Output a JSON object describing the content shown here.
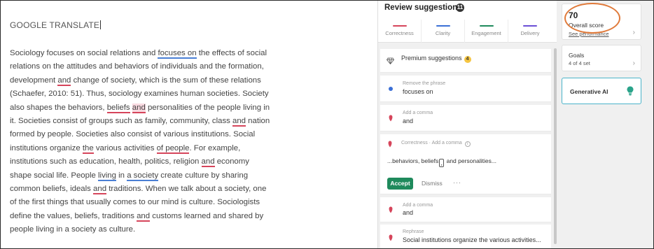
{
  "editor": {
    "doc_title": "GOOGLE TRANSLATE",
    "lines": [
      [
        {
          "t": "Sociology focuses on social relations and "
        },
        {
          "t": "focuses on",
          "u": "ub"
        },
        {
          "t": " the effects of social"
        }
      ],
      [
        {
          "t": "relations on the attitudes and behaviors of individuals and the formation,"
        }
      ],
      [
        {
          "t": "development "
        },
        {
          "t": "and",
          "u": "ur"
        },
        {
          "t": " change of society, which is the sum of these relations"
        }
      ],
      [
        {
          "t": "(Schaefer, 2010: 51). Thus, sociology examines human societies. Society"
        }
      ],
      [
        {
          "t": "also shapes the behaviors, "
        },
        {
          "t": "beliefs",
          "u": "ur"
        },
        {
          "t": " "
        },
        {
          "t": "and",
          "u": "hl"
        },
        {
          "t": " personalities of the people living in"
        }
      ],
      [
        {
          "t": "it. Societies consist of groups such as family, community, class "
        },
        {
          "t": "and",
          "u": "ur"
        },
        {
          "t": " nation"
        }
      ],
      [
        {
          "t": "formed by people. Societies also consist of various institutions. Social"
        }
      ],
      [
        {
          "t": "institutions organize "
        },
        {
          "t": "the",
          "u": "ur"
        },
        {
          "t": " various activities "
        },
        {
          "t": "of people",
          "u": "ur"
        },
        {
          "t": ". For example,"
        }
      ],
      [
        {
          "t": "institutions such as education, health, politics, religion "
        },
        {
          "t": "and",
          "u": "ur"
        },
        {
          "t": " economy"
        }
      ],
      [
        {
          "t": "shape social life. People "
        },
        {
          "t": "living",
          "u": "ub"
        },
        {
          "t": " in "
        },
        {
          "t": "a society",
          "u": "ub"
        },
        {
          "t": " create culture by sharing"
        }
      ],
      [
        {
          "t": "common beliefs, ideals "
        },
        {
          "t": "and",
          "u": "ur"
        },
        {
          "t": " traditions. When we talk about a society, one"
        }
      ],
      [
        {
          "t": "of the first things that usually comes to our mind is culture. Sociologists"
        }
      ],
      [
        {
          "t": "define the values, beliefs, traditions "
        },
        {
          "t": "and",
          "u": "ur"
        },
        {
          "t": " customs learned and shared by"
        }
      ],
      [
        {
          "t": "people living in a society as culture."
        }
      ]
    ]
  },
  "panel": {
    "title": "Review suggestions",
    "count": "11",
    "categories": [
      {
        "label": "Correctness",
        "color": "#d6455b"
      },
      {
        "label": "Clarity",
        "color": "#3b6fd6"
      },
      {
        "label": "Engagement",
        "color": "#1f8a5c"
      },
      {
        "label": "Delivery",
        "color": "#6b4fd6"
      }
    ],
    "premium": {
      "label": "Premium suggestions",
      "count": "4"
    },
    "cards": [
      {
        "sub": "Remove the phrase",
        "main": "focuses on",
        "icon": "blue"
      },
      {
        "sub": "Add a comma",
        "main": "and",
        "icon": "red"
      },
      {
        "sub": "Add a comma",
        "main": "and",
        "icon": "red"
      },
      {
        "sub": "Rephrase",
        "main": "Social institutions organize the various activities...",
        "icon": "red"
      }
    ],
    "expanded": {
      "sub": "Correctness · Add a comma",
      "info": "i",
      "text_before": "...behaviors, beliefs",
      "inserted": ",",
      "text_after": " and personalities...",
      "accept": "Accept",
      "dismiss": "Dismiss",
      "more": "···"
    }
  },
  "sidebar": {
    "score": "70",
    "score_label": "Overall score",
    "score_link": "See performance",
    "chevron": "›",
    "goals_title": "Goals",
    "goals_sub": "4 of 4 set",
    "genai_label": "Generative AI"
  }
}
